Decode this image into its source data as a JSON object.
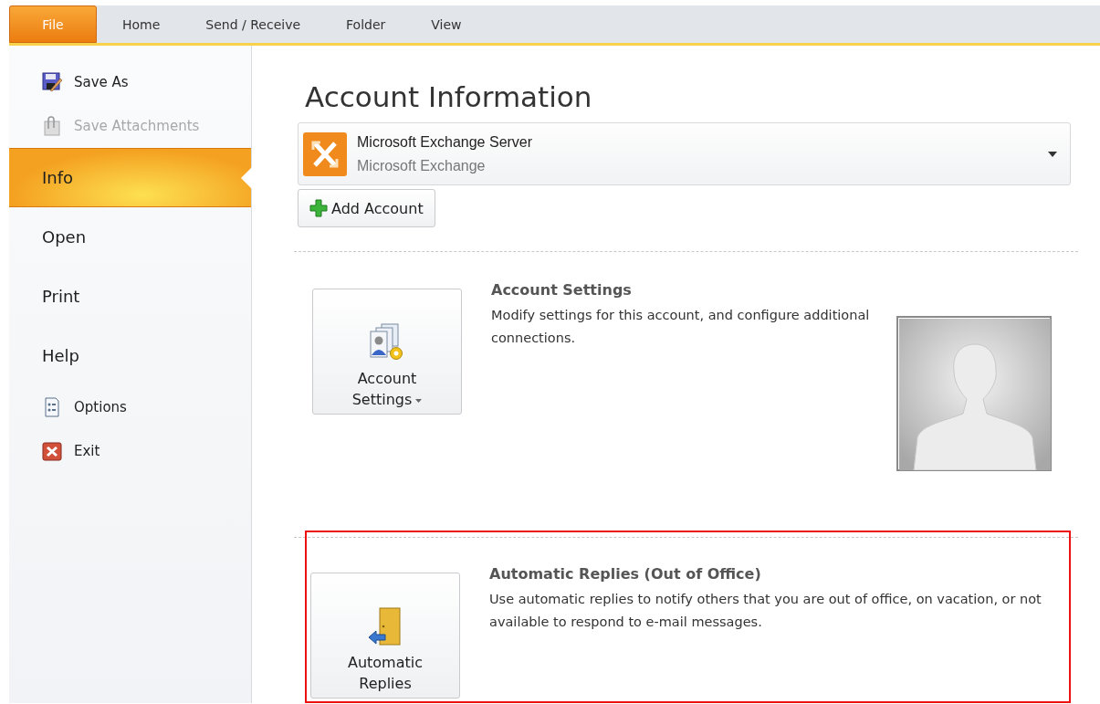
{
  "tabs": [
    {
      "label": "File",
      "selected": true
    },
    {
      "label": "Home",
      "selected": false
    },
    {
      "label": "Send / Receive",
      "selected": false
    },
    {
      "label": "Folder",
      "selected": false
    },
    {
      "label": "View",
      "selected": false
    }
  ],
  "sidebar": {
    "items": [
      {
        "label": "Save As",
        "kind": "command",
        "disabled": false,
        "selected": false
      },
      {
        "label": "Save Attachments",
        "kind": "command",
        "disabled": true,
        "selected": false
      },
      {
        "label": "Info",
        "kind": "nav",
        "disabled": false,
        "selected": true
      },
      {
        "label": "Open",
        "kind": "nav",
        "disabled": false,
        "selected": false
      },
      {
        "label": "Print",
        "kind": "nav",
        "disabled": false,
        "selected": false
      },
      {
        "label": "Help",
        "kind": "nav",
        "disabled": false,
        "selected": false
      },
      {
        "label": "Options",
        "kind": "command",
        "disabled": false,
        "selected": false
      },
      {
        "label": "Exit",
        "kind": "command",
        "disabled": false,
        "selected": false
      }
    ]
  },
  "title": "Account Information",
  "account": {
    "name": "Microsoft Exchange Server",
    "type": "Microsoft Exchange"
  },
  "add_account_button": "Add Account",
  "sections": [
    {
      "button_lines": [
        "Account",
        "Settings"
      ],
      "dropdown": true,
      "title": "Account Settings",
      "description": "Modify settings for this account, and configure additional connections.",
      "highlighted": false,
      "avatar": true
    },
    {
      "button_lines": [
        "Automatic",
        "Replies"
      ],
      "dropdown": false,
      "title": "Automatic Replies (Out of Office)",
      "description": "Use automatic replies to notify others that you are out of office, on vacation, or not available to respond to e-mail messages.",
      "highlighted": true,
      "avatar": false
    }
  ]
}
